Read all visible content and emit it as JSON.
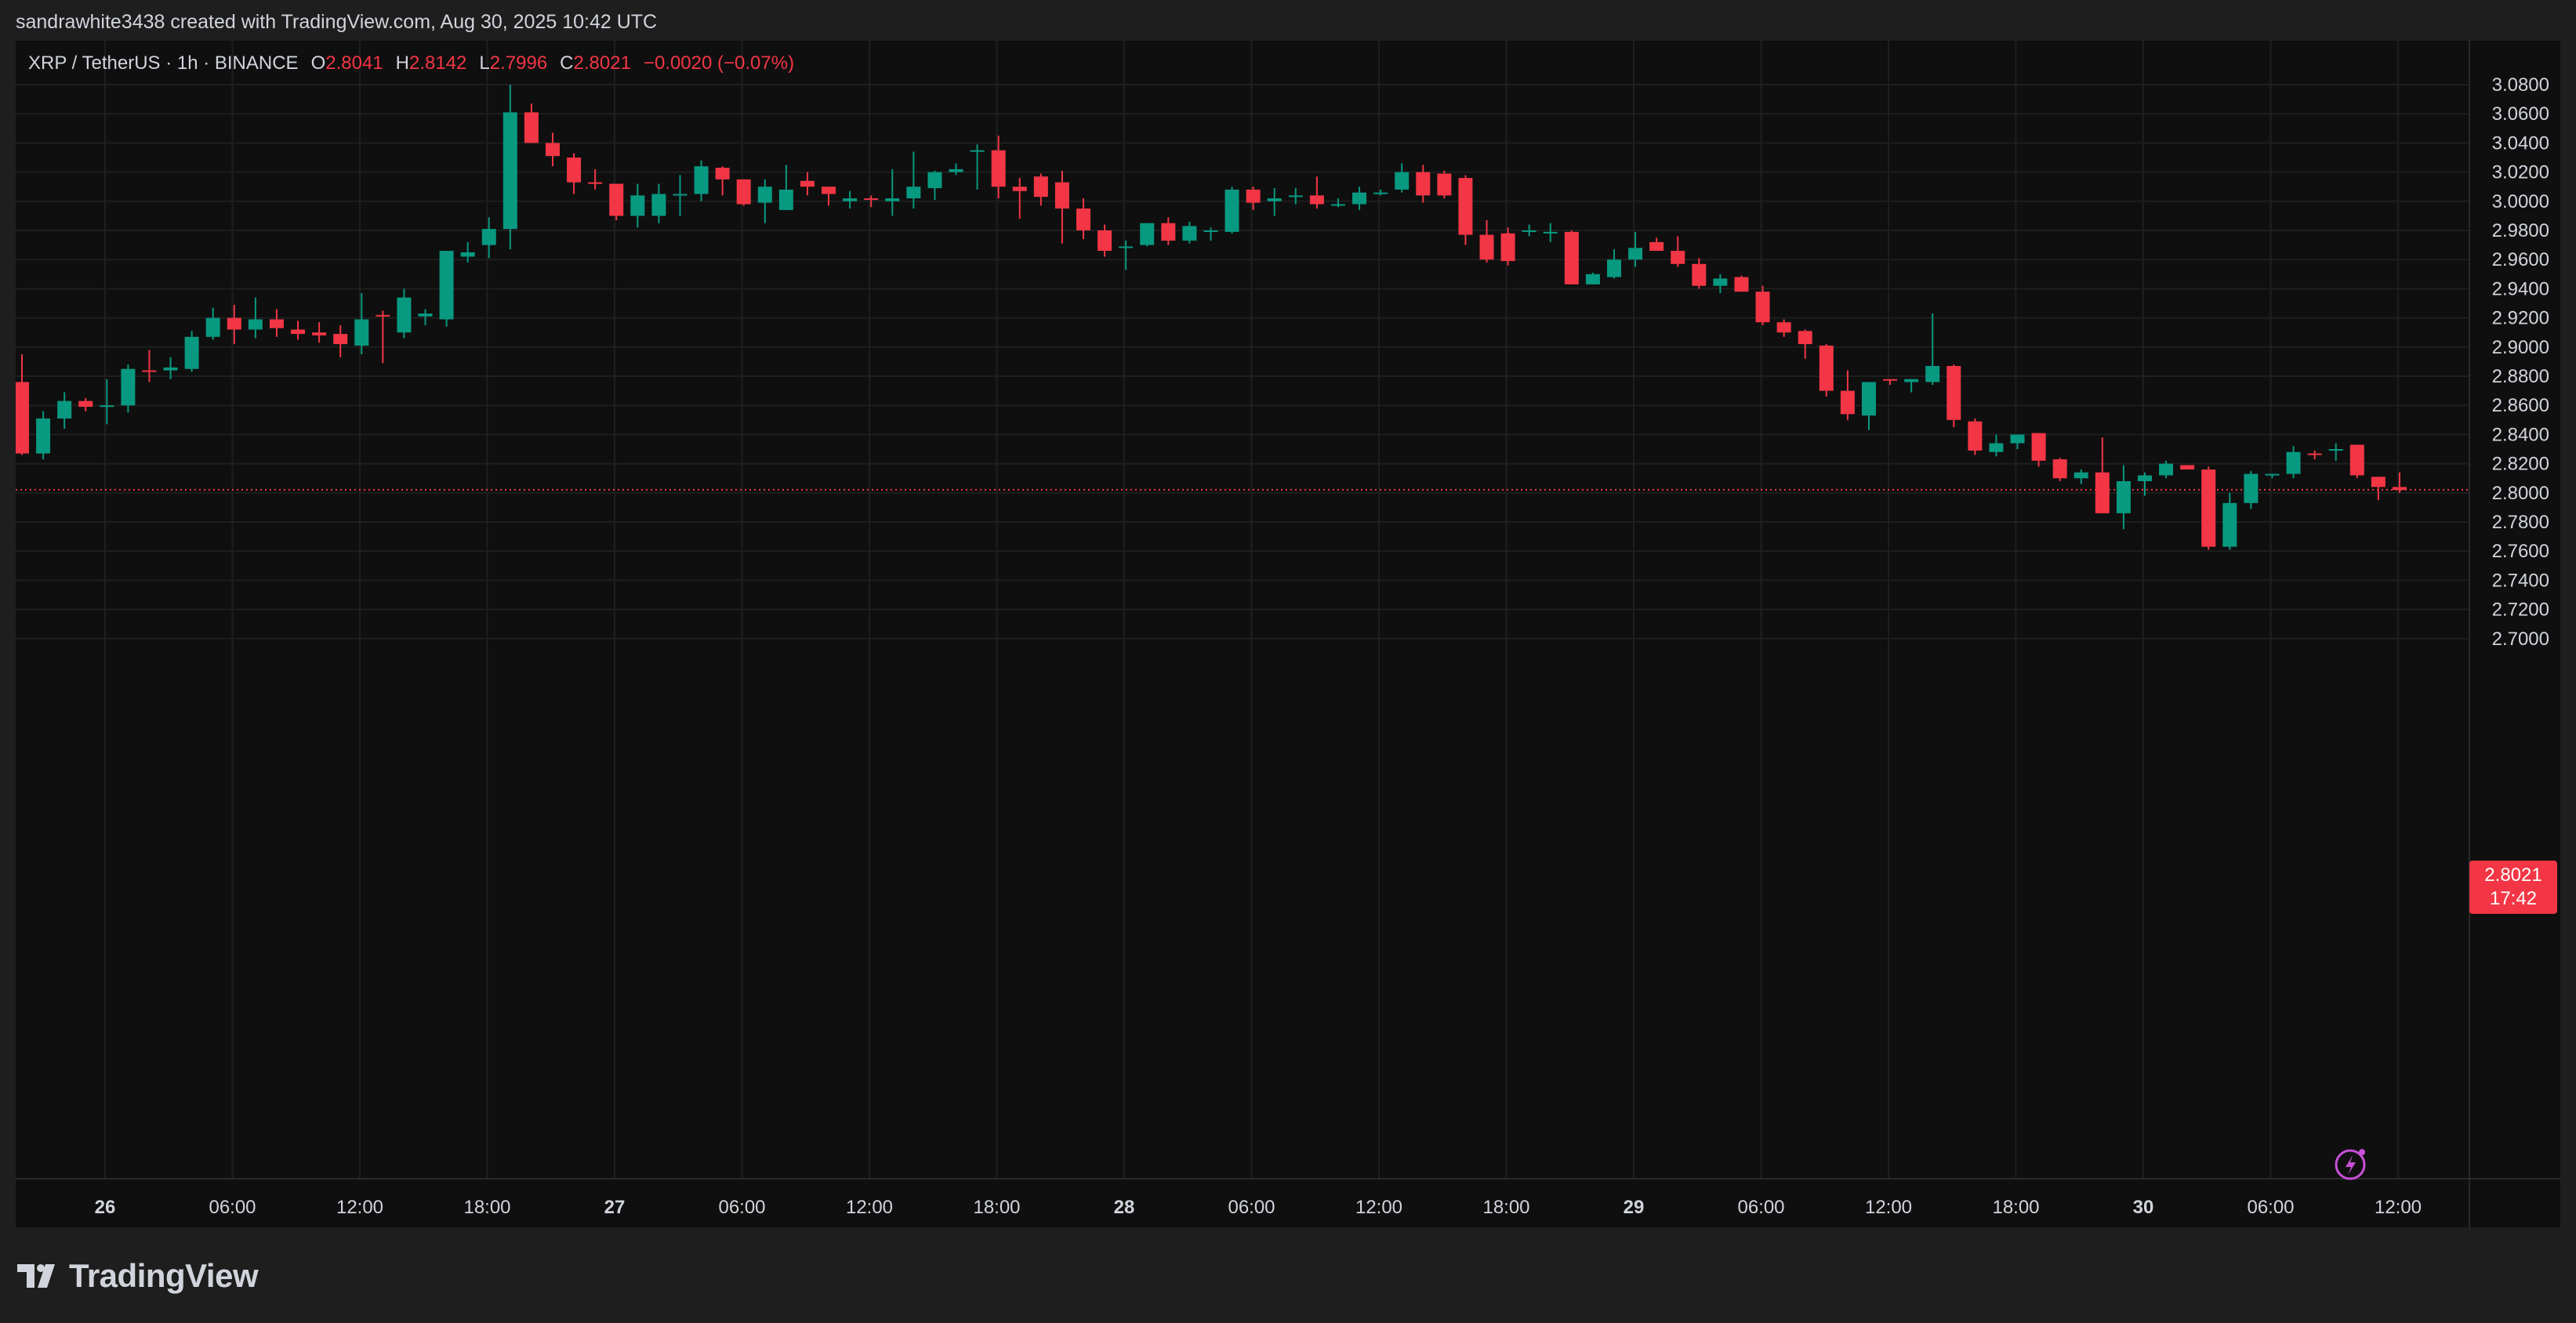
{
  "creator_line": "sandrawhite3438 created with TradingView.com, Aug 30, 2025 10:42 UTC",
  "brand": "TradingView",
  "legend": {
    "symbol": "XRP / TetherUS · 1h · BINANCE",
    "open_label": "O",
    "open": "2.8041",
    "high_label": "H",
    "high": "2.8142",
    "low_label": "L",
    "low": "2.7996",
    "close_label": "C",
    "close": "2.8021",
    "change": "−0.0020 (−0.07%)"
  },
  "last_price": {
    "price": "2.8021",
    "countdown": "17:42"
  },
  "colors": {
    "up": "#089981",
    "down": "#f23645",
    "background": "#0f0f0f",
    "grid": "#1f1f1f",
    "text": "#d1d4dc"
  },
  "chart_data": {
    "type": "candlestick",
    "interval": "1h",
    "ylim": [
      2.69,
      3.09
    ],
    "y_ticks": [
      "3.0800",
      "3.0600",
      "3.0400",
      "3.0200",
      "3.0000",
      "2.9800",
      "2.9600",
      "2.9400",
      "2.9200",
      "2.9000",
      "2.8800",
      "2.8600",
      "2.8400",
      "2.8200",
      "2.8000",
      "2.7800",
      "2.7600",
      "2.7400",
      "2.7200",
      "2.7000"
    ],
    "x_ticks": [
      {
        "label": "26",
        "bold": true
      },
      {
        "label": "06:00"
      },
      {
        "label": "12:00"
      },
      {
        "label": "18:00"
      },
      {
        "label": "27",
        "bold": true
      },
      {
        "label": "06:00"
      },
      {
        "label": "12:00"
      },
      {
        "label": "18:00"
      },
      {
        "label": "28",
        "bold": true
      },
      {
        "label": "06:00"
      },
      {
        "label": "12:00"
      },
      {
        "label": "18:00"
      },
      {
        "label": "29",
        "bold": true
      },
      {
        "label": "06:00"
      },
      {
        "label": "12:00"
      },
      {
        "label": "18:00"
      },
      {
        "label": "30",
        "bold": true
      },
      {
        "label": "06:00"
      },
      {
        "label": "12:00"
      }
    ],
    "ohlc": [
      [
        2.876,
        2.895,
        2.826,
        2.827
      ],
      [
        2.827,
        2.856,
        2.823,
        2.851
      ],
      [
        2.851,
        2.869,
        2.844,
        2.863
      ],
      [
        2.863,
        2.865,
        2.856,
        2.859
      ],
      [
        2.859,
        2.878,
        2.847,
        2.86
      ],
      [
        2.86,
        2.888,
        2.855,
        2.885
      ],
      [
        2.884,
        2.898,
        2.876,
        2.883
      ],
      [
        2.884,
        2.893,
        2.878,
        2.886
      ],
      [
        2.885,
        2.911,
        2.883,
        2.907
      ],
      [
        2.907,
        2.927,
        2.905,
        2.92
      ],
      [
        2.92,
        2.929,
        2.902,
        2.912
      ],
      [
        2.912,
        2.934,
        2.906,
        2.919
      ],
      [
        2.919,
        2.926,
        2.907,
        2.913
      ],
      [
        2.912,
        2.918,
        2.905,
        2.909
      ],
      [
        2.91,
        2.917,
        2.903,
        2.908
      ],
      [
        2.909,
        2.915,
        2.893,
        2.902
      ],
      [
        2.901,
        2.937,
        2.895,
        2.919
      ],
      [
        2.922,
        2.925,
        2.889,
        2.921
      ],
      [
        2.91,
        2.94,
        2.906,
        2.934
      ],
      [
        2.921,
        2.926,
        2.915,
        2.923
      ],
      [
        2.919,
        2.965,
        2.914,
        2.966
      ],
      [
        2.962,
        2.972,
        2.958,
        2.965
      ],
      [
        2.97,
        2.989,
        2.961,
        2.981
      ],
      [
        2.981,
        3.08,
        2.967,
        3.061
      ],
      [
        3.061,
        3.067,
        3.047,
        3.04
      ],
      [
        3.04,
        3.047,
        3.024,
        3.031
      ],
      [
        3.03,
        3.033,
        3.005,
        3.013
      ],
      [
        3.013,
        3.022,
        3.008,
        3.012
      ],
      [
        3.012,
        3.012,
        2.987,
        2.99
      ],
      [
        2.99,
        3.012,
        2.982,
        3.004
      ],
      [
        2.99,
        3.012,
        2.985,
        3.005
      ],
      [
        3.005,
        3.018,
        2.99,
        3.005
      ],
      [
        3.005,
        3.028,
        3.0,
        3.024
      ],
      [
        3.023,
        3.024,
        3.004,
        3.015
      ],
      [
        3.015,
        3.015,
        2.997,
        2.998
      ],
      [
        2.999,
        3.015,
        2.985,
        3.01
      ],
      [
        2.994,
        3.025,
        2.994,
        3.008
      ],
      [
        3.014,
        3.02,
        3.004,
        3.01
      ],
      [
        3.01,
        3.01,
        2.997,
        3.005
      ],
      [
        3.0,
        3.007,
        2.995,
        3.002
      ],
      [
        3.002,
        3.004,
        2.996,
        3.001
      ],
      [
        3.0,
        3.022,
        2.99,
        3.002
      ],
      [
        3.002,
        3.034,
        2.995,
        3.01
      ],
      [
        3.009,
        3.021,
        3.001,
        3.02
      ],
      [
        3.02,
        3.026,
        3.018,
        3.022
      ],
      [
        3.035,
        3.039,
        3.008,
        3.035
      ],
      [
        3.035,
        3.045,
        3.002,
        3.01
      ],
      [
        3.01,
        3.016,
        2.988,
        3.007
      ],
      [
        3.017,
        3.019,
        2.997,
        3.003
      ],
      [
        3.013,
        3.021,
        2.971,
        2.995
      ],
      [
        2.995,
        3.002,
        2.974,
        2.98
      ],
      [
        2.98,
        2.984,
        2.962,
        2.966
      ],
      [
        2.969,
        2.973,
        2.953,
        2.969
      ],
      [
        2.97,
        2.984,
        2.969,
        2.985
      ],
      [
        2.985,
        2.989,
        2.97,
        2.973
      ],
      [
        2.973,
        2.986,
        2.971,
        2.983
      ],
      [
        2.979,
        2.982,
        2.973,
        2.98
      ],
      [
        2.979,
        3.01,
        2.978,
        3.008
      ],
      [
        3.008,
        3.01,
        2.994,
        2.999
      ],
      [
        3.0,
        3.009,
        2.99,
        3.002
      ],
      [
        3.003,
        3.009,
        2.998,
        3.004
      ],
      [
        3.004,
        3.017,
        2.995,
        2.998
      ],
      [
        2.998,
        3.002,
        2.996,
        2.998
      ],
      [
        2.998,
        3.01,
        2.994,
        3.006
      ],
      [
        3.005,
        3.008,
        3.004,
        3.006
      ],
      [
        3.008,
        3.026,
        3.006,
        3.02
      ],
      [
        3.02,
        3.025,
        2.999,
        3.004
      ],
      [
        3.019,
        3.021,
        3.002,
        3.004
      ],
      [
        3.016,
        3.018,
        2.97,
        2.977
      ],
      [
        2.977,
        2.987,
        2.958,
        2.96
      ],
      [
        2.978,
        2.982,
        2.956,
        2.959
      ],
      [
        2.979,
        2.984,
        2.976,
        2.98
      ],
      [
        2.978,
        2.985,
        2.972,
        2.979
      ],
      [
        2.979,
        2.98,
        2.943,
        2.943
      ],
      [
        2.943,
        2.951,
        2.943,
        2.95
      ],
      [
        2.948,
        2.967,
        2.947,
        2.96
      ],
      [
        2.96,
        2.979,
        2.955,
        2.968
      ],
      [
        2.972,
        2.975,
        2.966,
        2.966
      ],
      [
        2.966,
        2.976,
        2.955,
        2.957
      ],
      [
        2.957,
        2.961,
        2.94,
        2.942
      ],
      [
        2.942,
        2.95,
        2.937,
        2.947
      ],
      [
        2.948,
        2.949,
        2.938,
        2.938
      ],
      [
        2.938,
        2.942,
        2.915,
        2.917
      ],
      [
        2.917,
        2.919,
        2.907,
        2.91
      ],
      [
        2.911,
        2.912,
        2.892,
        2.902
      ],
      [
        2.901,
        2.902,
        2.866,
        2.87
      ],
      [
        2.87,
        2.884,
        2.85,
        2.854
      ],
      [
        2.853,
        2.875,
        2.843,
        2.876
      ],
      [
        2.878,
        2.878,
        2.874,
        2.877
      ],
      [
        2.876,
        2.878,
        2.869,
        2.878
      ],
      [
        2.876,
        2.923,
        2.874,
        2.887
      ],
      [
        2.887,
        2.888,
        2.845,
        2.85
      ],
      [
        2.849,
        2.851,
        2.826,
        2.829
      ],
      [
        2.828,
        2.84,
        2.825,
        2.834
      ],
      [
        2.834,
        2.838,
        2.83,
        2.84
      ],
      [
        2.841,
        2.841,
        2.818,
        2.822
      ],
      [
        2.823,
        2.824,
        2.808,
        2.81
      ],
      [
        2.81,
        2.816,
        2.806,
        2.814
      ],
      [
        2.814,
        2.838,
        2.787,
        2.786
      ],
      [
        2.786,
        2.819,
        2.775,
        2.808
      ],
      [
        2.808,
        2.814,
        2.798,
        2.812
      ],
      [
        2.812,
        2.822,
        2.81,
        2.82
      ],
      [
        2.819,
        2.819,
        2.817,
        2.816
      ],
      [
        2.816,
        2.818,
        2.761,
        2.763
      ],
      [
        2.763,
        2.8,
        2.761,
        2.793
      ],
      [
        2.793,
        2.815,
        2.789,
        2.813
      ],
      [
        2.812,
        2.813,
        2.81,
        2.813
      ],
      [
        2.813,
        2.832,
        2.81,
        2.828
      ],
      [
        2.827,
        2.829,
        2.823,
        2.826
      ],
      [
        2.83,
        2.834,
        2.822,
        2.83
      ],
      [
        2.833,
        2.833,
        2.81,
        2.812
      ],
      [
        2.811,
        2.811,
        2.795,
        2.804
      ],
      [
        2.804,
        2.814,
        2.8,
        2.802
      ]
    ],
    "last_price": 2.8021,
    "grid": true
  }
}
